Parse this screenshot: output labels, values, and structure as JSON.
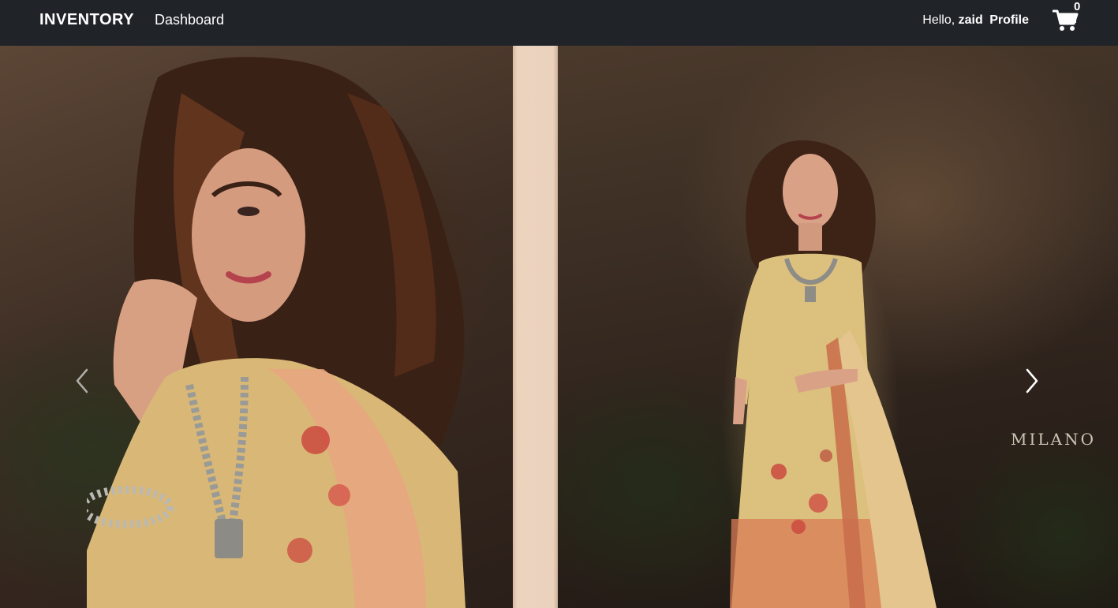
{
  "navbar": {
    "brand": "INVENTORY",
    "dashboard_link": "Dashboard",
    "greeting_prefix": "Hello,",
    "username": "zaid",
    "profile_link": "Profile",
    "cart_count": "0",
    "cart_icon": "shopping-cart-icon",
    "background_color": "#202328"
  },
  "carousel": {
    "prev_icon": "chevron-left-icon",
    "next_icon": "chevron-right-icon",
    "slides": [
      {
        "kind": "photo",
        "description_icon": "model-closeup-photo"
      },
      {
        "kind": "photo",
        "description_icon": "model-fullbody-photo"
      }
    ],
    "watermark": "MILANO"
  }
}
